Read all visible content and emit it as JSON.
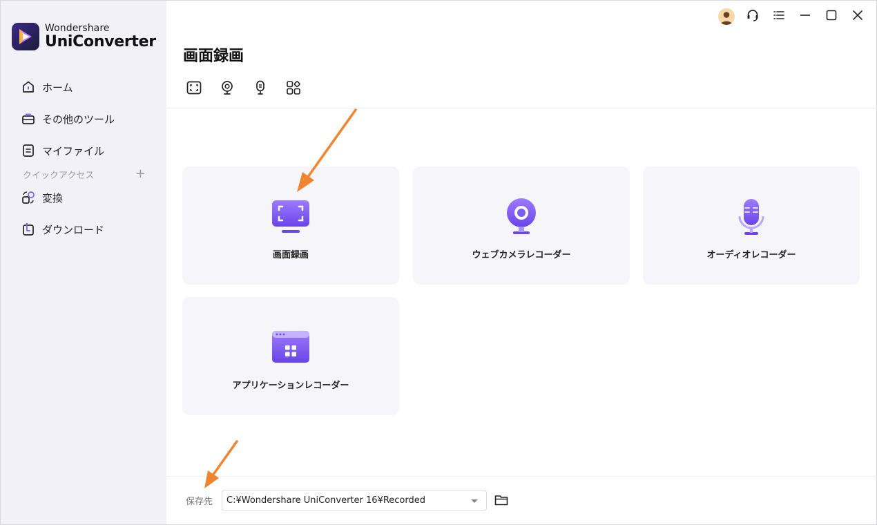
{
  "brand": {
    "sub": "Wondershare",
    "main": "UniConverter"
  },
  "sidebar": {
    "items": [
      {
        "label": "ホーム",
        "icon": "home-icon"
      },
      {
        "label": "その他のツール",
        "icon": "toolbox-icon"
      },
      {
        "label": "マイファイル",
        "icon": "file-icon"
      }
    ],
    "quick_access": {
      "label": "クイックアクセス",
      "add": "+"
    },
    "quick_items": [
      {
        "label": "変換",
        "icon": "convert-icon"
      },
      {
        "label": "ダウンロード",
        "icon": "download-icon"
      }
    ]
  },
  "main": {
    "title": "画面録画",
    "tabs": [
      "screen-record-tab-icon",
      "webcam-tab-icon",
      "audio-tab-icon",
      "apps-tab-icon"
    ],
    "cards": [
      {
        "label": "画面録画",
        "icon": "screen-recorder-icon"
      },
      {
        "label": "ウェブカメラレコーダー",
        "icon": "webcam-recorder-icon"
      },
      {
        "label": "オーディオレコーダー",
        "icon": "audio-recorder-icon"
      },
      {
        "label": "アプリケーションレコーダー",
        "icon": "app-recorder-icon"
      }
    ]
  },
  "bottom": {
    "save_label": "保存先",
    "path": "C:¥Wondershare UniConverter 16¥Recorded"
  },
  "colors": {
    "accent": "#7b5cf5",
    "annotation_arrow": "#f0852d",
    "sidebar_bg": "#f2f1f8",
    "card_bg": "#f6f6fa"
  }
}
